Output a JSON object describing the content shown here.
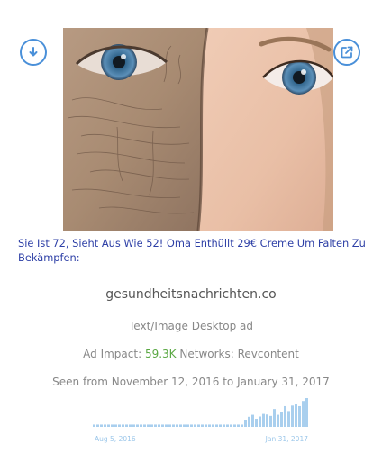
{
  "actions": {
    "download_icon": "download-circle-icon",
    "share_icon": "external-link-icon"
  },
  "ad": {
    "headline": "Sie Ist 72, Sieht Aus Wie 52! Oma Enthüllt 29€ Creme Um Falten Zu Bekämpfen:",
    "domain": "gesundheitsnachrichten.co",
    "ad_type": "Text/Image Desktop ad",
    "impact_label": "Ad Impact:",
    "impact_value": "59.3K",
    "networks_label": "Networks:",
    "networks_value": "Revcontent",
    "seen_text": "Seen from November 12, 2016 to January 31, 2017"
  },
  "colors": {
    "accent": "#4a90d9",
    "headline": "#2d3fa6",
    "impact": "#5aa843",
    "bar": "#a9cfee"
  },
  "chart_data": {
    "type": "bar",
    "x_start_label": "Aug 5, 2016",
    "x_end_label": "Jan 31, 2017",
    "values": [
      0.08,
      0.08,
      0.08,
      0.08,
      0.08,
      0.08,
      0.08,
      0.08,
      0.08,
      0.08,
      0.08,
      0.08,
      0.08,
      0.08,
      0.08,
      0.08,
      0.08,
      0.08,
      0.08,
      0.08,
      0.08,
      0.08,
      0.08,
      0.08,
      0.08,
      0.08,
      0.08,
      0.08,
      0.08,
      0.08,
      0.08,
      0.08,
      0.08,
      0.08,
      0.08,
      0.08,
      0.08,
      0.08,
      0.08,
      0.08,
      0.08,
      0.08,
      0.25,
      0.35,
      0.42,
      0.28,
      0.36,
      0.45,
      0.43,
      0.38,
      0.62,
      0.42,
      0.5,
      0.72,
      0.55,
      0.74,
      0.78,
      0.72,
      0.9,
      1.0
    ]
  }
}
